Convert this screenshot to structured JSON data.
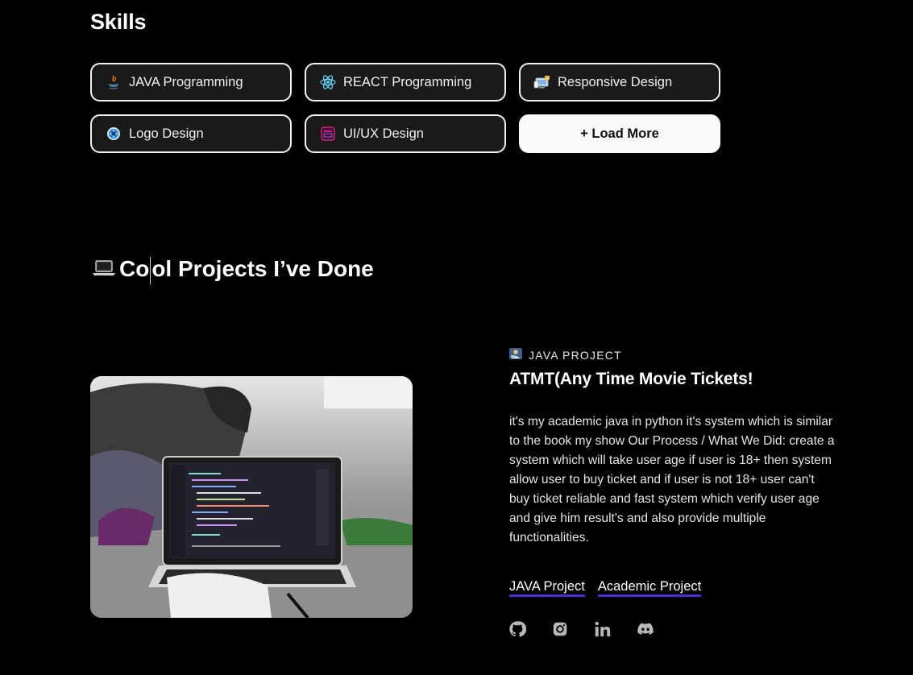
{
  "skills": {
    "title": "Skills",
    "items": [
      {
        "label": "JAVA Programming",
        "icon": "java-icon"
      },
      {
        "label": "REACT Programming",
        "icon": "react-icon"
      },
      {
        "label": "Responsive Design",
        "icon": "responsive-design-icon"
      },
      {
        "label": "Logo Design",
        "icon": "logo-design-icon"
      },
      {
        "label": "UI/UX Design",
        "icon": "uiux-icon"
      }
    ],
    "load_more_label": "+ Load More"
  },
  "projects": {
    "title_emoji": "💻",
    "title_pre": "Co",
    "title_post": "ol Projects I’ve Done",
    "item": {
      "kicker": "JAVA PROJECT",
      "kicker_icon": "developer-emoji-icon",
      "title": "ATMT(Any Time Movie Tickets!",
      "description": "it's my academic java in python it's system which is similar to the book my show Our Process / What We Did: create a system which will take user age if user is 18+ then system allow user to buy ticket and if user is not 18+ user can't buy ticket reliable and fast system which verify user age and give him result's and also provide multiple functionalities.",
      "tags": [
        "JAVA Project",
        "Academic Project"
      ],
      "socials": [
        "github-icon",
        "instagram-icon",
        "linkedin-icon",
        "discord-icon"
      ],
      "image": "laptop-code-photo"
    }
  },
  "colors": {
    "background": "#000000",
    "chip_bg": "#1a1a1a",
    "chip_border": "#f2f2f2",
    "tag_underline": "#4b2bd1",
    "social_icon": "#b8b8b8"
  }
}
